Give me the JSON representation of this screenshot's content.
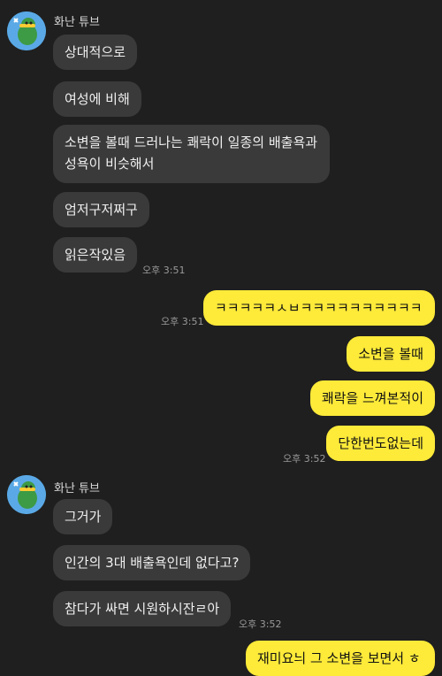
{
  "sender": {
    "name": "화난 튜브",
    "avatar_icon": "angry-duck-icon"
  },
  "messages_block1": [
    "상대적으로",
    "여성에 비해",
    "소변을 볼때 드러나는 쾌락이 일종의 배출욕과 성욕이 비슷해서",
    "엄저구저쩌구",
    "읽은작있음"
  ],
  "time_block1": "오후 3:51",
  "my_block1": {
    "messages": [
      "ㅋㅋㅋㅋㅋㅅㅂㅋㅋㅋㅋㅋㅋㅋㅋㅋㅋ"
    ],
    "time": "오후 3:51"
  },
  "my_block2": {
    "messages": [
      "소변을 볼때",
      "쾌락을 느껴본적이",
      "단한번도없는데"
    ],
    "time": "오후 3:52"
  },
  "messages_block2": [
    "그거가",
    "인간의 3대 배출욕인데 없다고?",
    "참다가 싸면 시원하시잔ㄹ아"
  ],
  "time_block2": "오후 3:52",
  "my_partial": "재미요늬 그 소변을 보면서 ㅎ"
}
